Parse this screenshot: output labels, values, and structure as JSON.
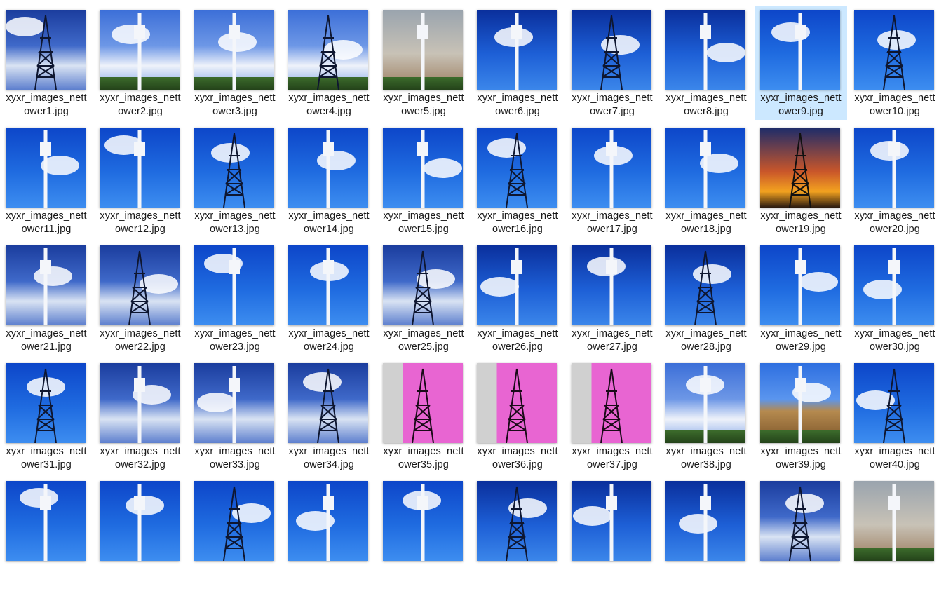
{
  "files": [
    {
      "line1": "xyxr_images_nett",
      "line2": "ower1.jpg",
      "style": "skyA"
    },
    {
      "line1": "xyxr_images_nett",
      "line2": "ower2.jpg",
      "style": "skyC"
    },
    {
      "line1": "xyxr_images_nett",
      "line2": "ower3.jpg",
      "style": "skyC"
    },
    {
      "line1": "xyxr_images_nett",
      "line2": "ower4.jpg",
      "style": "skyC"
    },
    {
      "line1": "xyxr_images_nett",
      "line2": "ower5.jpg",
      "style": "photo"
    },
    {
      "line1": "xyxr_images_nett",
      "line2": "ower6.jpg",
      "style": "skyD"
    },
    {
      "line1": "xyxr_images_nett",
      "line2": "ower7.jpg",
      "style": "skyD"
    },
    {
      "line1": "xyxr_images_nett",
      "line2": "ower8.jpg",
      "style": "skyD"
    },
    {
      "line1": "xyxr_images_nett",
      "line2": "ower9.jpg",
      "style": "skyB",
      "selected": true
    },
    {
      "line1": "xyxr_images_nett",
      "line2": "ower10.jpg",
      "style": "skyB"
    },
    {
      "line1": "xyxr_images_nett",
      "line2": "ower11.jpg",
      "style": "skyB"
    },
    {
      "line1": "xyxr_images_nett",
      "line2": "ower12.jpg",
      "style": "skyB"
    },
    {
      "line1": "xyxr_images_nett",
      "line2": "ower13.jpg",
      "style": "skyB"
    },
    {
      "line1": "xyxr_images_nett",
      "line2": "ower14.jpg",
      "style": "skyB"
    },
    {
      "line1": "xyxr_images_nett",
      "line2": "ower15.jpg",
      "style": "skyB"
    },
    {
      "line1": "xyxr_images_nett",
      "line2": "ower16.jpg",
      "style": "skyB"
    },
    {
      "line1": "xyxr_images_nett",
      "line2": "ower17.jpg",
      "style": "skyB"
    },
    {
      "line1": "xyxr_images_nett",
      "line2": "ower18.jpg",
      "style": "skyB"
    },
    {
      "line1": "xyxr_images_nett",
      "line2": "ower19.jpg",
      "style": "sunset"
    },
    {
      "line1": "xyxr_images_nett",
      "line2": "ower20.jpg",
      "style": "skyB"
    },
    {
      "line1": "xyxr_images_nett",
      "line2": "ower21.jpg",
      "style": "skyA"
    },
    {
      "line1": "xyxr_images_nett",
      "line2": "ower22.jpg",
      "style": "skyA"
    },
    {
      "line1": "xyxr_images_nett",
      "line2": "ower23.jpg",
      "style": "skyB"
    },
    {
      "line1": "xyxr_images_nett",
      "line2": "ower24.jpg",
      "style": "skyB"
    },
    {
      "line1": "xyxr_images_nett",
      "line2": "ower25.jpg",
      "style": "skyA"
    },
    {
      "line1": "xyxr_images_nett",
      "line2": "ower26.jpg",
      "style": "skyD"
    },
    {
      "line1": "xyxr_images_nett",
      "line2": "ower27.jpg",
      "style": "skyD"
    },
    {
      "line1": "xyxr_images_nett",
      "line2": "ower28.jpg",
      "style": "skyD"
    },
    {
      "line1": "xyxr_images_nett",
      "line2": "ower29.jpg",
      "style": "skyB"
    },
    {
      "line1": "xyxr_images_nett",
      "line2": "ower30.jpg",
      "style": "skyB"
    },
    {
      "line1": "xyxr_images_nett",
      "line2": "ower31.jpg",
      "style": "skyB"
    },
    {
      "line1": "xyxr_images_nett",
      "line2": "ower32.jpg",
      "style": "skyA"
    },
    {
      "line1": "xyxr_images_nett",
      "line2": "ower33.jpg",
      "style": "skyA"
    },
    {
      "line1": "xyxr_images_nett",
      "line2": "ower34.jpg",
      "style": "skyA"
    },
    {
      "line1": "xyxr_images_nett",
      "line2": "ower35.jpg",
      "style": "pink"
    },
    {
      "line1": "xyxr_images_nett",
      "line2": "ower36.jpg",
      "style": "pink"
    },
    {
      "line1": "xyxr_images_nett",
      "line2": "ower37.jpg",
      "style": "pink"
    },
    {
      "line1": "xyxr_images_nett",
      "line2": "ower38.jpg",
      "style": "skyC"
    },
    {
      "line1": "xyxr_images_nett",
      "line2": "ower39.jpg",
      "style": "ruins"
    },
    {
      "line1": "xyxr_images_nett",
      "line2": "ower40.jpg",
      "style": "skyB"
    },
    {
      "line1": "",
      "line2": "",
      "style": "skyB"
    },
    {
      "line1": "",
      "line2": "",
      "style": "skyB"
    },
    {
      "line1": "",
      "line2": "",
      "style": "skyB"
    },
    {
      "line1": "",
      "line2": "",
      "style": "skyB"
    },
    {
      "line1": "",
      "line2": "",
      "style": "skyB"
    },
    {
      "line1": "",
      "line2": "",
      "style": "skyD"
    },
    {
      "line1": "",
      "line2": "",
      "style": "skyD"
    },
    {
      "line1": "",
      "line2": "",
      "style": "skyD"
    },
    {
      "line1": "",
      "line2": "",
      "style": "skyA"
    },
    {
      "line1": "",
      "line2": "",
      "style": "photo"
    }
  ],
  "colors": {
    "selection": "#cce8ff",
    "caption_text": "#1a1a1a"
  }
}
